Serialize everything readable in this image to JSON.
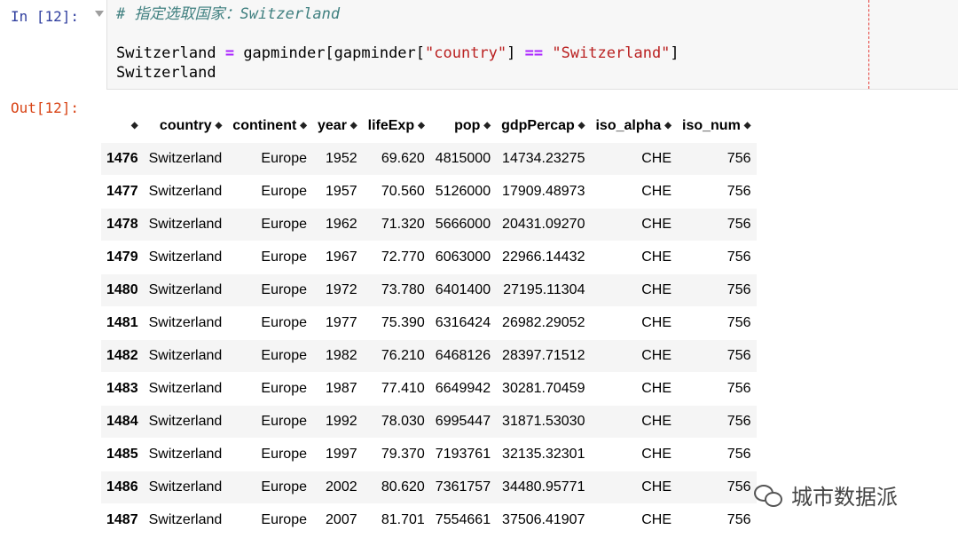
{
  "cell": {
    "in_prompt": "In [12]:",
    "out_prompt": "Out[12]:",
    "code": {
      "comment": "# 指定选取国家：Switzerland",
      "line2_var": "Switzerland ",
      "line2_op1": "=",
      "line2_mid1": " gapminder[gapminder[",
      "line2_str1": "\"country\"",
      "line2_mid2": "] ",
      "line2_op2": "==",
      "line2_str2": "\"Switzerland\"",
      "line2_end": "]",
      "line3": "Switzerland"
    }
  },
  "table": {
    "columns": [
      "",
      "country",
      "continent",
      "year",
      "lifeExp",
      "pop",
      "gdpPercap",
      "iso_alpha",
      "iso_num"
    ],
    "rows": [
      [
        "1476",
        "Switzerland",
        "Europe",
        "1952",
        "69.620",
        "4815000",
        "14734.23275",
        "CHE",
        "756"
      ],
      [
        "1477",
        "Switzerland",
        "Europe",
        "1957",
        "70.560",
        "5126000",
        "17909.48973",
        "CHE",
        "756"
      ],
      [
        "1478",
        "Switzerland",
        "Europe",
        "1962",
        "71.320",
        "5666000",
        "20431.09270",
        "CHE",
        "756"
      ],
      [
        "1479",
        "Switzerland",
        "Europe",
        "1967",
        "72.770",
        "6063000",
        "22966.14432",
        "CHE",
        "756"
      ],
      [
        "1480",
        "Switzerland",
        "Europe",
        "1972",
        "73.780",
        "6401400",
        "27195.11304",
        "CHE",
        "756"
      ],
      [
        "1481",
        "Switzerland",
        "Europe",
        "1977",
        "75.390",
        "6316424",
        "26982.29052",
        "CHE",
        "756"
      ],
      [
        "1482",
        "Switzerland",
        "Europe",
        "1982",
        "76.210",
        "6468126",
        "28397.71512",
        "CHE",
        "756"
      ],
      [
        "1483",
        "Switzerland",
        "Europe",
        "1987",
        "77.410",
        "6649942",
        "30281.70459",
        "CHE",
        "756"
      ],
      [
        "1484",
        "Switzerland",
        "Europe",
        "1992",
        "78.030",
        "6995447",
        "31871.53030",
        "CHE",
        "756"
      ],
      [
        "1485",
        "Switzerland",
        "Europe",
        "1997",
        "79.370",
        "7193761",
        "32135.32301",
        "CHE",
        "756"
      ],
      [
        "1486",
        "Switzerland",
        "Europe",
        "2002",
        "80.620",
        "7361757",
        "34480.95771",
        "CHE",
        "756"
      ],
      [
        "1487",
        "Switzerland",
        "Europe",
        "2007",
        "81.701",
        "7554661",
        "37506.41907",
        "CHE",
        "756"
      ]
    ]
  },
  "watermark": {
    "text": "城市数据派",
    "icon": "wechat-icon"
  }
}
